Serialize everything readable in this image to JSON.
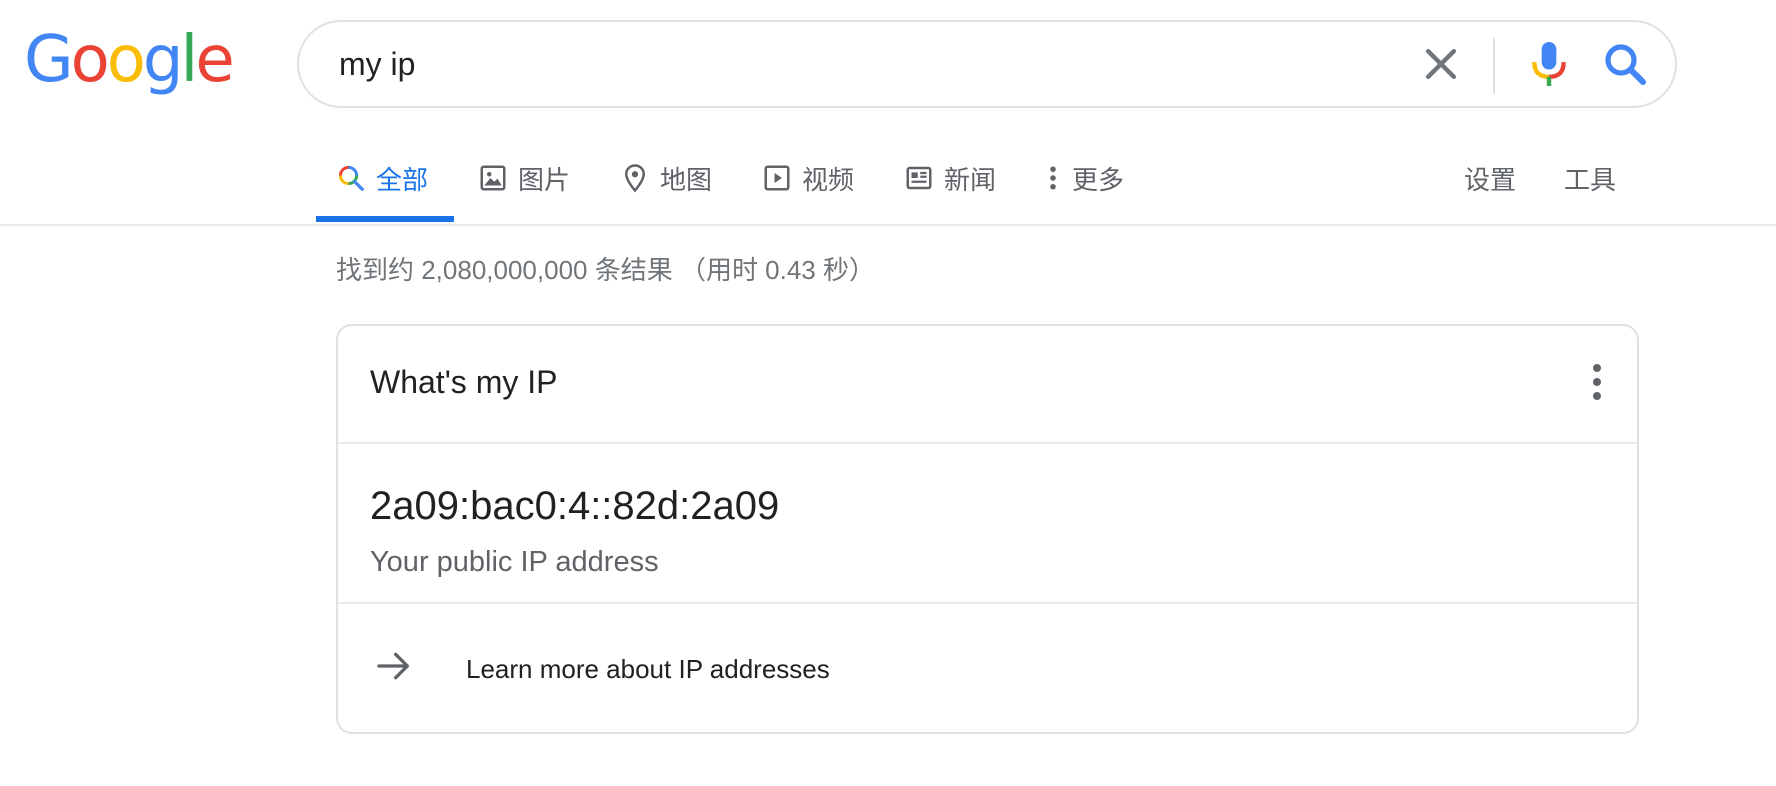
{
  "logo": {
    "letters": [
      {
        "ch": "G",
        "color": "#4285F4"
      },
      {
        "ch": "o",
        "color": "#EA4335"
      },
      {
        "ch": "o",
        "color": "#FBBC05"
      },
      {
        "ch": "g",
        "color": "#4285F4"
      },
      {
        "ch": "l",
        "color": "#34A853"
      },
      {
        "ch": "e",
        "color": "#EA4335"
      }
    ]
  },
  "search": {
    "query": "my ip"
  },
  "tabs": [
    {
      "label": "全部",
      "icon": "search-icon",
      "active": true
    },
    {
      "label": "图片",
      "icon": "image-icon"
    },
    {
      "label": "地图",
      "icon": "map-pin-icon"
    },
    {
      "label": "视频",
      "icon": "play-icon"
    },
    {
      "label": "新闻",
      "icon": "news-icon"
    },
    {
      "label": "更多",
      "icon": "more-vert-icon"
    }
  ],
  "tools": [
    {
      "label": "设置"
    },
    {
      "label": "工具"
    }
  ],
  "result_stats": "找到约 2,080,000,000 条结果 （用时 0.43 秒）",
  "card": {
    "title": "What's my IP",
    "ip": "2a09:bac0:4::82d:2a09",
    "caption": "Your public IP address",
    "learn_more": "Learn more about IP addresses"
  },
  "colors": {
    "accent": "#1a73e8",
    "text": "#202124",
    "muted": "#5f6368",
    "border": "#dfe1e5"
  }
}
